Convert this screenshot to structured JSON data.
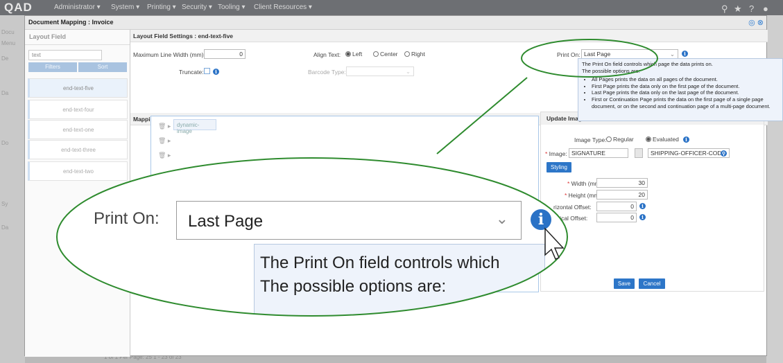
{
  "topbar": {
    "brand": "QAD",
    "menu": [
      "Administrator ▾",
      "System ▾",
      "Printing ▾",
      "Security ▾",
      "Tooling ▾",
      "Client Resources ▾"
    ]
  },
  "background": {
    "left_labels": [
      "Docu",
      "Menu",
      "De",
      "Da",
      "Do",
      "Sy",
      "Da"
    ],
    "pager": "1 of 1  Per Page: 25  1 - 23 of 23"
  },
  "dialog": {
    "title": "Document Mapping : Invoice",
    "left": {
      "header": "Layout Field",
      "search_value": "text",
      "filters_label": "Filters",
      "sort_label": "Sort",
      "items": [
        "end-text-five",
        "end-text-four",
        "end-text-one",
        "end-text-three",
        "end-text-two"
      ]
    },
    "settings": {
      "header": "Layout Field Settings : end-text-five",
      "max_width_label": "Maximum Line Width (mm):",
      "max_width_value": "0",
      "align_label": "Align Text:",
      "align_options": [
        "Left",
        "Center",
        "Right"
      ],
      "align_selected": "Left",
      "truncate_label": "Truncate:",
      "barcode_label": "Barcode Type:",
      "print_on_label": "Print On:",
      "print_on_value": "Last Page"
    },
    "mapping": {
      "header": "Mapping Details",
      "chip": "dynamic-image"
    },
    "update": {
      "header": "Update Imag",
      "image_type_label": "Image Type:",
      "image_type_options": [
        "Regular",
        "Evaluated"
      ],
      "image_type_selected": "Evaluated",
      "image_label": "Image:",
      "image_value": "SIGNATURE",
      "image_code": "SHIPPING-OFFICER-COD",
      "styling_label": "Styling",
      "width_label": "Width (mm):",
      "width_value": "30",
      "height_label": "Height (mm):",
      "height_value": "20",
      "hoff_label": "rizontal Offset:",
      "hoff_value": "0",
      "voff_label": "rtical Offset:",
      "voff_value": "0",
      "save_label": "Save",
      "cancel_label": "Cancel"
    }
  },
  "tooltip": {
    "line1": "The Print On field controls which page the data prints on.",
    "line2": "The possible options are:",
    "bullets": [
      "All Pages prints the data on all pages of the document.",
      "First Page prints the data only on the first page of the document.",
      "Last Page prints the data only on the last page of the document.",
      "First or Continuation Page prints the data on the first page of a single page document, or on the second and continuation page of a multi-page document."
    ]
  },
  "zoom": {
    "label": "Print On:",
    "value": "Last Page",
    "tip_line1": "The Print On field controls which",
    "tip_line2": "The possible options are:"
  },
  "colors": {
    "accent": "#2a72c6",
    "callout": "#2e8b2e"
  }
}
